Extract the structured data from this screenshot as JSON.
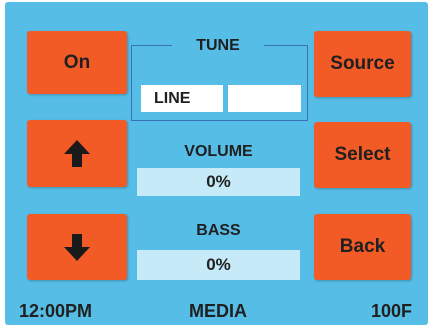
{
  "buttons": {
    "on": "On",
    "source": "Source",
    "select": "Select",
    "back": "Back",
    "up_icon": "arrow-up-icon",
    "down_icon": "arrow-down-icon"
  },
  "tune": {
    "title": "TUNE",
    "field_left": "LINE",
    "field_right": ""
  },
  "volume": {
    "label": "VOLUME",
    "value": "0%"
  },
  "bass": {
    "label": "BASS",
    "value": "0%"
  },
  "status_bar": {
    "time": "12:00PM",
    "mode": "MEDIA",
    "temperature": "100F"
  },
  "colors": {
    "background": "#56bde6",
    "button": "#f25a26",
    "value_box": "#c7eaf8",
    "frame": "#3a72b8"
  }
}
